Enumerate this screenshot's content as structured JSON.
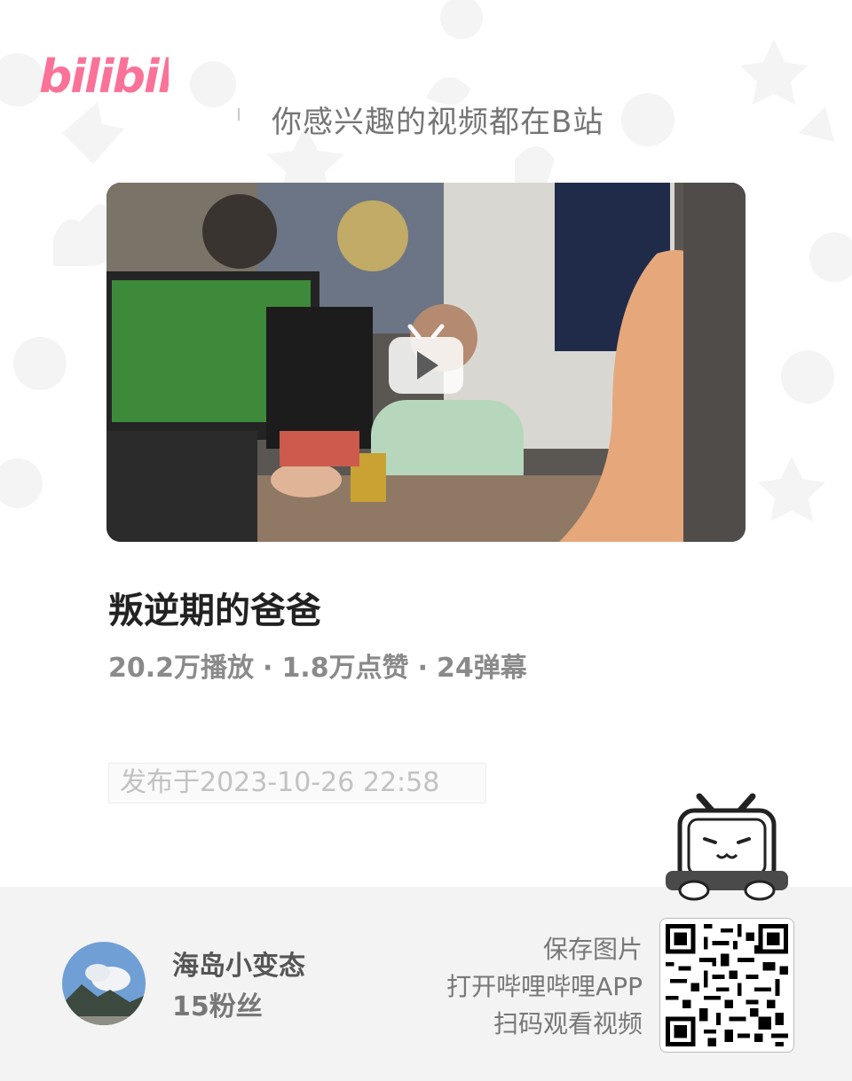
{
  "header": {
    "logo_text": "bilibili",
    "slogan": "你感兴趣的视频都在B站"
  },
  "video": {
    "title": "叛逆期的爸爸",
    "stats": {
      "plays": "20.2万播放",
      "likes": "1.8万点赞",
      "danmaku": "24弹幕",
      "separator": "·"
    },
    "published": "发布于2023-10-26 22:58"
  },
  "uploader": {
    "name": "海岛小变态",
    "fans": "15粉丝"
  },
  "qr": {
    "line1": "保存图片",
    "line2": "打开哔哩哔哩APP",
    "line3": "扫码观看视频"
  },
  "colors": {
    "brand_pink": "#fb7299",
    "footer_bg": "#f3f3f3"
  },
  "icons": {
    "play": "play-icon",
    "mascot": "tv-mascot-icon",
    "qr": "qr-code"
  }
}
